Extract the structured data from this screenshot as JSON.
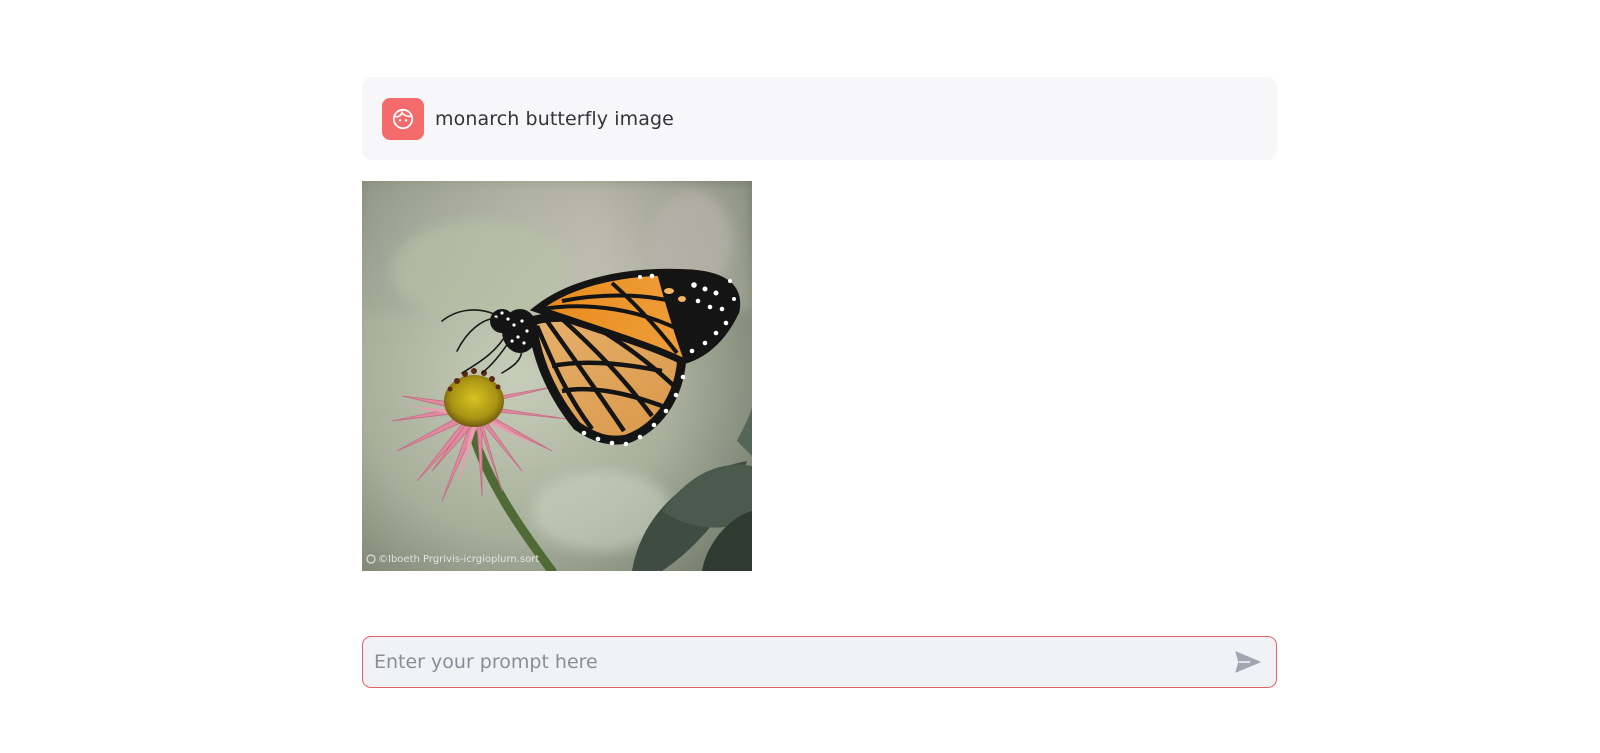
{
  "chat": {
    "user_message": "monarch butterfly image",
    "avatar_icon": "smiley-face-icon",
    "image_watermark": "©Iboeth Prgrivis-icrgioplurn.sort"
  },
  "prompt": {
    "placeholder": "Enter your prompt here",
    "value": "",
    "send_icon": "send-arrow-icon"
  },
  "colors": {
    "avatar_bg": "#f56b6b",
    "input_border": "#e06464",
    "input_bg": "#f0f2f6",
    "message_bg": "#f7f7f9"
  }
}
